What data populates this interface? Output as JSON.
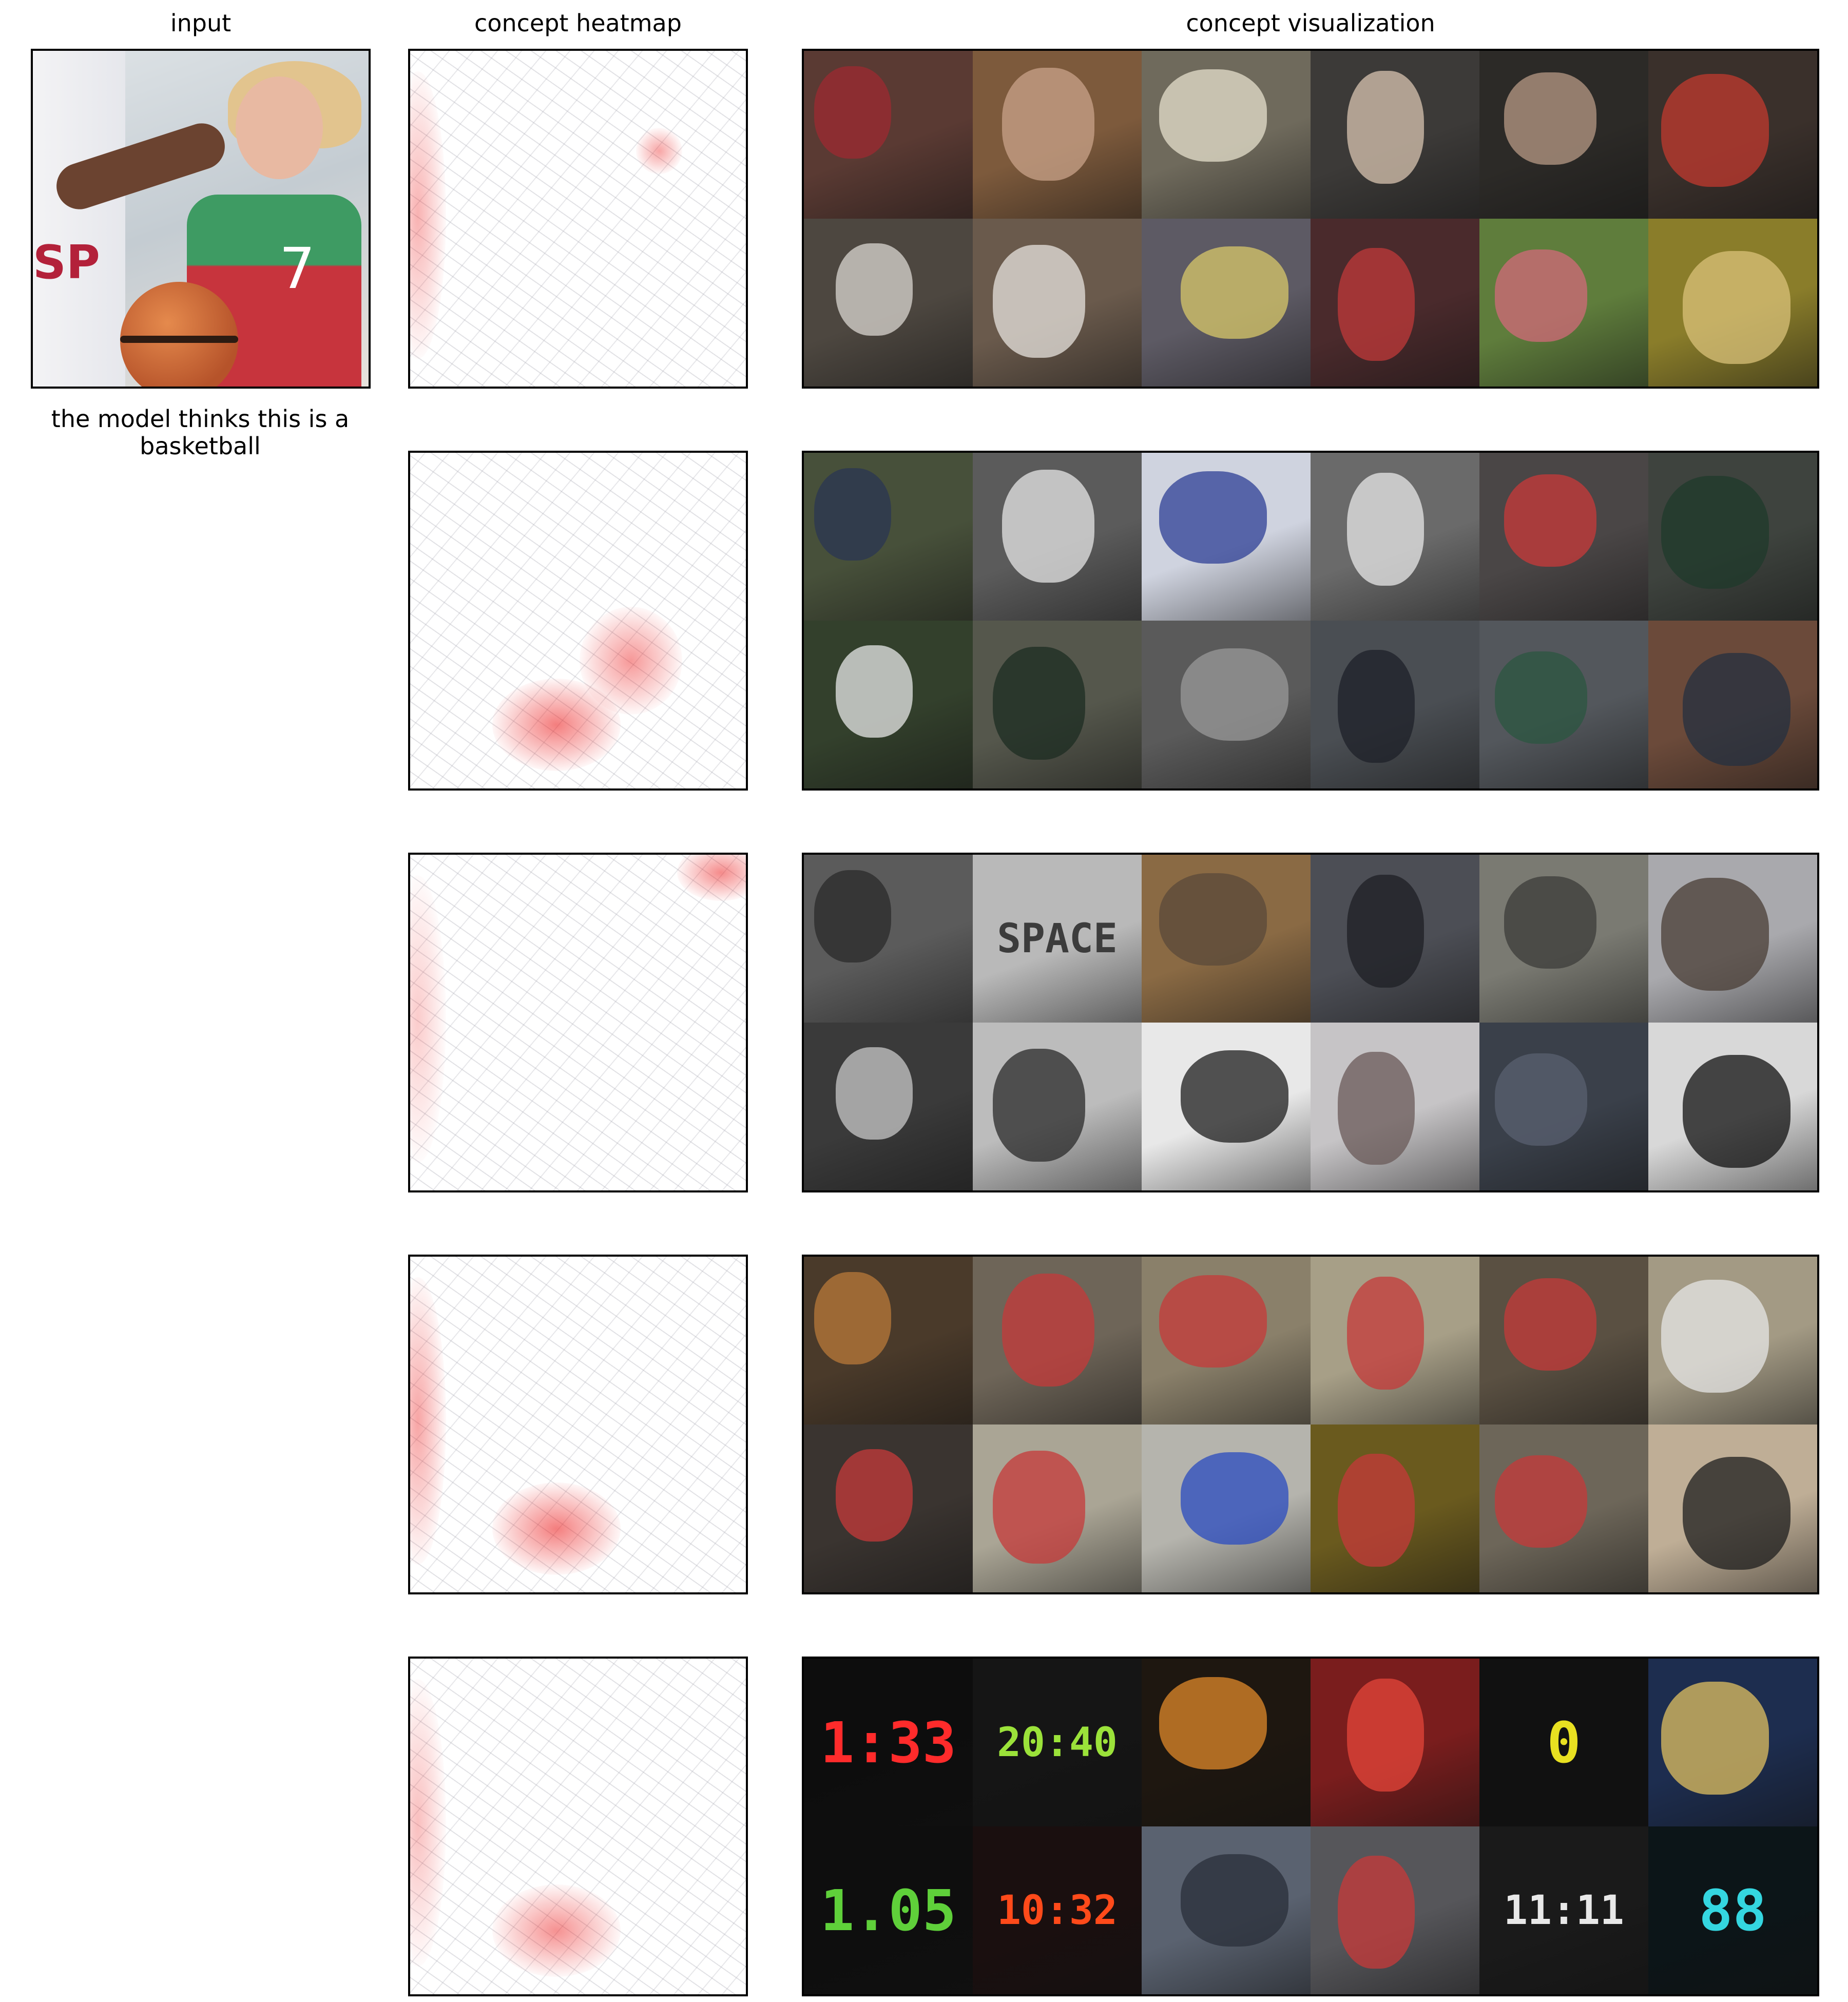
{
  "column_titles": {
    "input": "input",
    "heatmap": "concept heatmap",
    "visualization": "concept visualization"
  },
  "caption": "the model thinks this is a basketball",
  "input_image_text": {
    "jersey_number": "7",
    "left_jersey": "SP"
  },
  "concepts": [
    {
      "heat": {
        "blobs": [
          {
            "kind": "edge",
            "intensity": 0.6
          },
          {
            "kind": "face",
            "intensity": 0.7
          }
        ]
      },
      "tiles": [
        {
          "bg": "#5a3a33",
          "accent": "#9e2a31"
        },
        {
          "bg": "#7d5a3c",
          "accent": "#c9a38a"
        },
        {
          "bg": "#6f6a5c",
          "accent": "#e5e0cc"
        },
        {
          "bg": "#3c3a38",
          "accent": "#d8c4b0"
        },
        {
          "bg": "#2c2a27",
          "accent": "#b79a86"
        },
        {
          "bg": "#3a302b",
          "accent": "#c2392f"
        },
        {
          "bg": "#4d4740",
          "accent": "#d9d6d0"
        },
        {
          "bg": "#6a5a4c",
          "accent": "#e7e3dd"
        },
        {
          "bg": "#5d5a64",
          "accent": "#d8c86a"
        },
        {
          "bg": "#4a2a2c",
          "accent": "#c03a3a"
        },
        {
          "bg": "#5f7d3c",
          "accent": "#d26a7a"
        },
        {
          "bg": "#8a7d2a",
          "accent": "#d9c27a"
        }
      ]
    },
    {
      "heat": {
        "blobs": [
          {
            "kind": "ball",
            "intensity": 1.0
          },
          {
            "kind": "jersey",
            "intensity": 0.8
          }
        ]
      },
      "tiles": [
        {
          "bg": "#47503a",
          "accent": "#2a3553"
        },
        {
          "bg": "#5b5b5b",
          "accent": "#e6e6e6"
        },
        {
          "bg": "#cfd3df",
          "accent": "#2e3f95"
        },
        {
          "bg": "#6a6a6a",
          "accent": "#e8e8e8"
        },
        {
          "bg": "#4a4646",
          "accent": "#c93a3a"
        },
        {
          "bg": "#3e433e",
          "accent": "#1f3a2b"
        },
        {
          "bg": "#33402c",
          "accent": "#e7e7e7"
        },
        {
          "bg": "#55574c",
          "accent": "#1c2c22"
        },
        {
          "bg": "#5a5a5a",
          "accent": "#9a9a9a"
        },
        {
          "bg": "#4a4e53",
          "accent": "#1d2028"
        },
        {
          "bg": "#53575c",
          "accent": "#2b5640"
        },
        {
          "bg": "#6b4a3a",
          "accent": "#243040"
        }
      ]
    },
    {
      "heat": {
        "blobs": [
          {
            "kind": "corner",
            "intensity": 0.9
          },
          {
            "kind": "edge",
            "intensity": 0.4
          }
        ]
      },
      "tiles": [
        {
          "bg": "#5b5b5b",
          "accent": "#2a2a2a"
        },
        {
          "bg": "#b9b9b9",
          "accent": "#3c3c3c",
          "text": "SPACE"
        },
        {
          "bg": "#8a6a44",
          "accent": "#5a4a3a"
        },
        {
          "bg": "#4c4e55",
          "accent": "#1d1f24"
        },
        {
          "bg": "#7a7a72",
          "accent": "#3c3c3a"
        },
        {
          "bg": "#a9a9ad",
          "accent": "#4a3d36"
        },
        {
          "bg": "#3a3a3a",
          "accent": "#c8c8c8"
        },
        {
          "bg": "#bcbcbc",
          "accent": "#2a2a2a"
        },
        {
          "bg": "#e8e8e8",
          "accent": "#1d1d1d"
        },
        {
          "bg": "#c6c4c6",
          "accent": "#6a5a58"
        },
        {
          "bg": "#3a404a",
          "accent": "#5a6070"
        },
        {
          "bg": "#d8d8d8",
          "accent": "#111111"
        }
      ]
    },
    {
      "heat": {
        "blobs": [
          {
            "kind": "ball",
            "intensity": 1.0
          },
          {
            "kind": "edge",
            "intensity": 0.7
          }
        ]
      },
      "tiles": [
        {
          "bg": "#4a3a2a",
          "accent": "#b97a3a"
        },
        {
          "bg": "#6e6558",
          "accent": "#c63a3a"
        },
        {
          "bg": "#8a806a",
          "accent": "#c63a3a"
        },
        {
          "bg": "#a79f87",
          "accent": "#c63a3a"
        },
        {
          "bg": "#5a5042",
          "accent": "#c63a3a"
        },
        {
          "bg": "#a39a84",
          "accent": "#e6e6e6"
        },
        {
          "bg": "#3a3430",
          "accent": "#c63a3a"
        },
        {
          "bg": "#aaa595",
          "accent": "#c63a3a"
        },
        {
          "bg": "#b5b4ad",
          "accent": "#2a4bc0"
        },
        {
          "bg": "#6a5a1e",
          "accent": "#c63a3a"
        },
        {
          "bg": "#6d6659",
          "accent": "#c63a3a"
        },
        {
          "bg": "#bfae96",
          "accent": "#1d1d1d"
        }
      ]
    },
    {
      "heat": {
        "blobs": [
          {
            "kind": "ball",
            "intensity": 0.85
          },
          {
            "kind": "edge",
            "intensity": 0.5
          }
        ]
      },
      "tiles": [
        {
          "bg": "#0d0d0d",
          "accent": "#ff2b2b",
          "text": "1:33"
        },
        {
          "bg": "#151515",
          "accent": "#9be23a",
          "text": "20:40"
        },
        {
          "bg": "#1e1710",
          "accent": "#e08a2a"
        },
        {
          "bg": "#7a1d1d",
          "accent": "#e6453a"
        },
        {
          "bg": "#111111",
          "accent": "#e8e021",
          "text": "0"
        },
        {
          "bg": "#1d2d4f",
          "accent": "#e0c060"
        },
        {
          "bg": "#0e0e0e",
          "accent": "#5fd03a",
          "text": "1.05"
        },
        {
          "bg": "#1a0f0f",
          "accent": "#ff4a1a",
          "text": "10:32"
        },
        {
          "bg": "#5a6270",
          "accent": "#2a2f3a"
        },
        {
          "bg": "#56565a",
          "accent": "#c83a3a"
        },
        {
          "bg": "#1a1a1a",
          "accent": "#e8e8e8",
          "text": "11:11"
        },
        {
          "bg": "#0c1518",
          "accent": "#34d6e0",
          "text": "88"
        }
      ]
    }
  ]
}
